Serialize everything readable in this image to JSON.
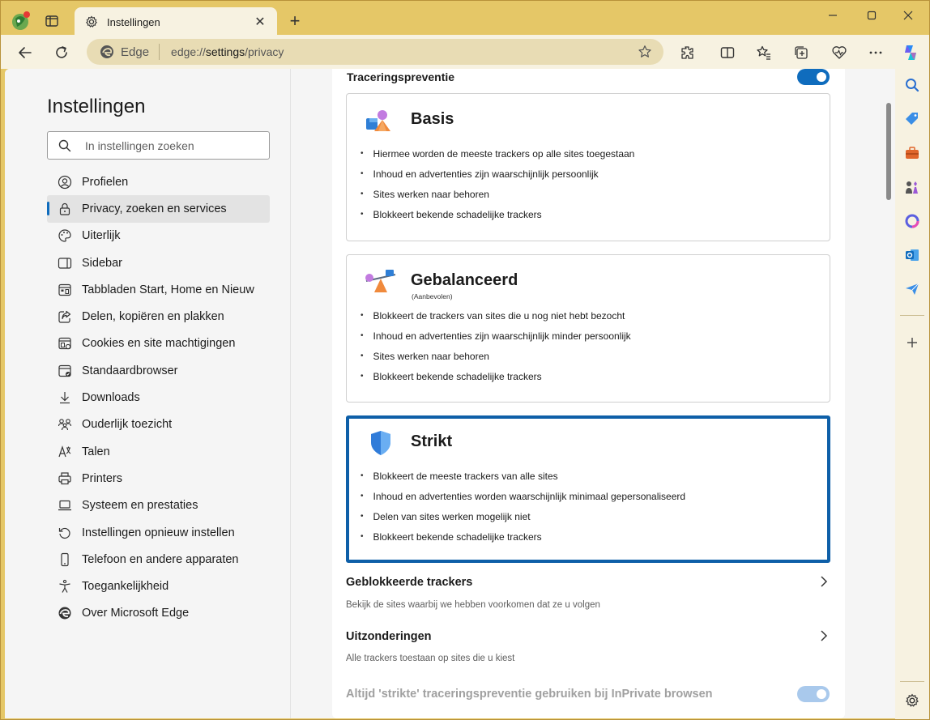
{
  "window": {
    "tab_title": "Instellingen"
  },
  "toolbar": {
    "site_name": "Edge",
    "url_prefix": "edge://",
    "url_path": "settings",
    "url_suffix": "/privacy"
  },
  "sidebar": {
    "title": "Instellingen",
    "search_placeholder": "In instellingen zoeken",
    "items": [
      {
        "label": "Profielen",
        "icon": "profile-icon"
      },
      {
        "label": "Privacy, zoeken en services",
        "icon": "lock-icon",
        "active": true
      },
      {
        "label": "Uiterlijk",
        "icon": "palette-icon"
      },
      {
        "label": "Sidebar",
        "icon": "sidebar-icon"
      },
      {
        "label": "Tabbladen Start, Home en Nieuw",
        "icon": "tabs-icon"
      },
      {
        "label": "Delen, kopiëren en plakken",
        "icon": "share-icon"
      },
      {
        "label": "Cookies en site machtigingen",
        "icon": "cookies-icon"
      },
      {
        "label": "Standaardbrowser",
        "icon": "browser-icon"
      },
      {
        "label": "Downloads",
        "icon": "download-icon"
      },
      {
        "label": "Ouderlijk toezicht",
        "icon": "family-icon"
      },
      {
        "label": "Talen",
        "icon": "language-icon"
      },
      {
        "label": "Printers",
        "icon": "printer-icon"
      },
      {
        "label": "Systeem en prestaties",
        "icon": "laptop-icon"
      },
      {
        "label": "Instellingen opnieuw instellen",
        "icon": "reset-icon"
      },
      {
        "label": "Telefoon en andere apparaten",
        "icon": "phone-icon"
      },
      {
        "label": "Toegankelijkheid",
        "icon": "accessibility-icon"
      },
      {
        "label": "Over Microsoft Edge",
        "icon": "edge-icon"
      }
    ]
  },
  "tracking": {
    "title": "Traceringspreventie",
    "enabled": true,
    "options": [
      {
        "title": "Basis",
        "subtitle": "",
        "selected": false,
        "bullets": [
          "Hiermee worden de meeste trackers op alle sites toegestaan",
          "Inhoud en advertenties zijn waarschijnlijk persoonlijk",
          "Sites werken naar behoren",
          "Blokkeert bekende schadelijke trackers"
        ]
      },
      {
        "title": "Gebalanceerd",
        "subtitle": "(Aanbevolen)",
        "selected": false,
        "bullets": [
          "Blokkeert de trackers van sites die u nog niet hebt bezocht",
          "Inhoud en advertenties zijn waarschijnlijk minder persoonlijk",
          "Sites werken naar behoren",
          "Blokkeert bekende schadelijke trackers"
        ]
      },
      {
        "title": "Strikt",
        "subtitle": "",
        "selected": true,
        "bullets": [
          "Blokkeert de meeste trackers van alle sites",
          "Inhoud en advertenties worden waarschijnlijk minimaal gepersonaliseerd",
          "Delen van sites werken mogelijk niet",
          "Blokkeert bekende schadelijke trackers"
        ]
      }
    ],
    "blocked": {
      "title": "Geblokkeerde trackers",
      "desc": "Bekijk de sites waarbij we hebben voorkomen dat ze u volgen"
    },
    "exceptions": {
      "title": "Uitzonderingen",
      "desc": "Alle trackers toestaan op sites die u kiest"
    },
    "inprivate": {
      "label": "Altijd 'strikte' traceringspreventie gebruiken bij InPrivate browsen",
      "enabled": true,
      "disabled_look": true
    }
  },
  "colors": {
    "frame": "#e5c767",
    "accent": "#0f6cbd",
    "selected_border": "#0e5fa8"
  }
}
